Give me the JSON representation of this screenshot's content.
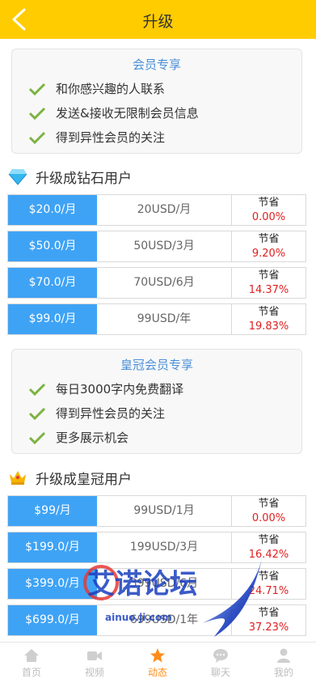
{
  "header": {
    "title": "升级",
    "back_icon": "chevron-left-icon"
  },
  "vip_card": {
    "title": "会员专享",
    "items": [
      "和你感兴趣的人联系",
      "发送&接收无限制会员信息",
      "得到异性会员的关注"
    ]
  },
  "diamond": {
    "heading": "升级成钻石用户",
    "icon": "diamond-icon",
    "plans": [
      {
        "price": "$20.0/月",
        "desc": "20USD/月",
        "save_label": "节省",
        "save": "0.00%"
      },
      {
        "price": "$50.0/月",
        "desc": "50USD/3月",
        "save_label": "节省",
        "save": "9.20%"
      },
      {
        "price": "$70.0/月",
        "desc": "70USD/6月",
        "save_label": "节省",
        "save": "14.37%"
      },
      {
        "price": "$99.0/月",
        "desc": "99USD/年",
        "save_label": "节省",
        "save": "19.83%"
      }
    ]
  },
  "crown_card": {
    "title": "皇冠会员专享",
    "items": [
      "每日3000字内免费翻译",
      "得到异性会员的关注",
      "更多展示机会"
    ]
  },
  "crown": {
    "heading": "升级成皇冠用户",
    "icon": "crown-icon",
    "plans": [
      {
        "price": "$99/月",
        "desc": "99USD/1月",
        "save_label": "节省",
        "save": "0.00%"
      },
      {
        "price": "$199.0/月",
        "desc": "199USD/3月",
        "save_label": "节省",
        "save": "16.42%"
      },
      {
        "price": "$399.0/月",
        "desc": "399USD/6月",
        "save_label": "节省",
        "save": "24.71%"
      },
      {
        "price": "$699.0/月",
        "desc": "699USD/1年",
        "save_label": "节省",
        "save": "37.23%"
      }
    ]
  },
  "tabbar": {
    "items": [
      {
        "label": "首页",
        "icon": "home-icon"
      },
      {
        "label": "视频",
        "icon": "video-icon"
      },
      {
        "label": "动态",
        "icon": "star-icon"
      },
      {
        "label": "聊天",
        "icon": "chat-icon"
      },
      {
        "label": "我的",
        "icon": "user-icon"
      }
    ],
    "active_index": 2
  },
  "watermark": {
    "text": "艾诺论坛",
    "url_text": "ainuo.ji.com"
  },
  "colors": {
    "header": "#FFCC00",
    "price_bg": "#3fa3f5",
    "save_text": "#e02020",
    "accent": "#ff8c1a",
    "check": "#7cb342"
  }
}
